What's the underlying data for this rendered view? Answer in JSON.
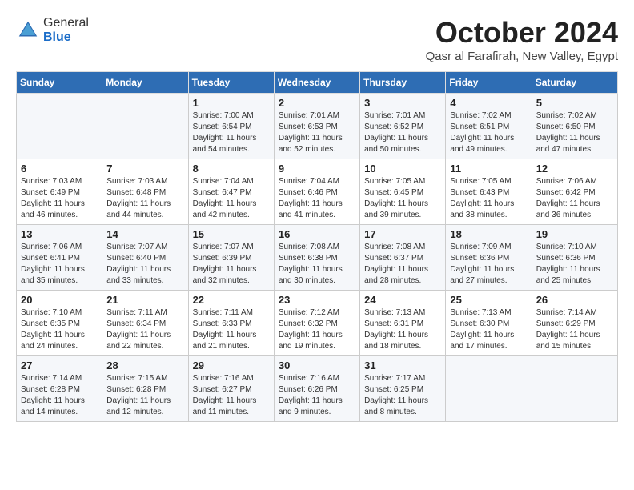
{
  "header": {
    "logo_general": "General",
    "logo_blue": "Blue",
    "month_title": "October 2024",
    "location": "Qasr al Farafirah, New Valley, Egypt"
  },
  "columns": [
    "Sunday",
    "Monday",
    "Tuesday",
    "Wednesday",
    "Thursday",
    "Friday",
    "Saturday"
  ],
  "weeks": [
    [
      {
        "day": "",
        "info": ""
      },
      {
        "day": "",
        "info": ""
      },
      {
        "day": "1",
        "info": "Sunrise: 7:00 AM\nSunset: 6:54 PM\nDaylight: 11 hours and 54 minutes."
      },
      {
        "day": "2",
        "info": "Sunrise: 7:01 AM\nSunset: 6:53 PM\nDaylight: 11 hours and 52 minutes."
      },
      {
        "day": "3",
        "info": "Sunrise: 7:01 AM\nSunset: 6:52 PM\nDaylight: 11 hours and 50 minutes."
      },
      {
        "day": "4",
        "info": "Sunrise: 7:02 AM\nSunset: 6:51 PM\nDaylight: 11 hours and 49 minutes."
      },
      {
        "day": "5",
        "info": "Sunrise: 7:02 AM\nSunset: 6:50 PM\nDaylight: 11 hours and 47 minutes."
      }
    ],
    [
      {
        "day": "6",
        "info": "Sunrise: 7:03 AM\nSunset: 6:49 PM\nDaylight: 11 hours and 46 minutes."
      },
      {
        "day": "7",
        "info": "Sunrise: 7:03 AM\nSunset: 6:48 PM\nDaylight: 11 hours and 44 minutes."
      },
      {
        "day": "8",
        "info": "Sunrise: 7:04 AM\nSunset: 6:47 PM\nDaylight: 11 hours and 42 minutes."
      },
      {
        "day": "9",
        "info": "Sunrise: 7:04 AM\nSunset: 6:46 PM\nDaylight: 11 hours and 41 minutes."
      },
      {
        "day": "10",
        "info": "Sunrise: 7:05 AM\nSunset: 6:45 PM\nDaylight: 11 hours and 39 minutes."
      },
      {
        "day": "11",
        "info": "Sunrise: 7:05 AM\nSunset: 6:43 PM\nDaylight: 11 hours and 38 minutes."
      },
      {
        "day": "12",
        "info": "Sunrise: 7:06 AM\nSunset: 6:42 PM\nDaylight: 11 hours and 36 minutes."
      }
    ],
    [
      {
        "day": "13",
        "info": "Sunrise: 7:06 AM\nSunset: 6:41 PM\nDaylight: 11 hours and 35 minutes."
      },
      {
        "day": "14",
        "info": "Sunrise: 7:07 AM\nSunset: 6:40 PM\nDaylight: 11 hours and 33 minutes."
      },
      {
        "day": "15",
        "info": "Sunrise: 7:07 AM\nSunset: 6:39 PM\nDaylight: 11 hours and 32 minutes."
      },
      {
        "day": "16",
        "info": "Sunrise: 7:08 AM\nSunset: 6:38 PM\nDaylight: 11 hours and 30 minutes."
      },
      {
        "day": "17",
        "info": "Sunrise: 7:08 AM\nSunset: 6:37 PM\nDaylight: 11 hours and 28 minutes."
      },
      {
        "day": "18",
        "info": "Sunrise: 7:09 AM\nSunset: 6:36 PM\nDaylight: 11 hours and 27 minutes."
      },
      {
        "day": "19",
        "info": "Sunrise: 7:10 AM\nSunset: 6:36 PM\nDaylight: 11 hours and 25 minutes."
      }
    ],
    [
      {
        "day": "20",
        "info": "Sunrise: 7:10 AM\nSunset: 6:35 PM\nDaylight: 11 hours and 24 minutes."
      },
      {
        "day": "21",
        "info": "Sunrise: 7:11 AM\nSunset: 6:34 PM\nDaylight: 11 hours and 22 minutes."
      },
      {
        "day": "22",
        "info": "Sunrise: 7:11 AM\nSunset: 6:33 PM\nDaylight: 11 hours and 21 minutes."
      },
      {
        "day": "23",
        "info": "Sunrise: 7:12 AM\nSunset: 6:32 PM\nDaylight: 11 hours and 19 minutes."
      },
      {
        "day": "24",
        "info": "Sunrise: 7:13 AM\nSunset: 6:31 PM\nDaylight: 11 hours and 18 minutes."
      },
      {
        "day": "25",
        "info": "Sunrise: 7:13 AM\nSunset: 6:30 PM\nDaylight: 11 hours and 17 minutes."
      },
      {
        "day": "26",
        "info": "Sunrise: 7:14 AM\nSunset: 6:29 PM\nDaylight: 11 hours and 15 minutes."
      }
    ],
    [
      {
        "day": "27",
        "info": "Sunrise: 7:14 AM\nSunset: 6:28 PM\nDaylight: 11 hours and 14 minutes."
      },
      {
        "day": "28",
        "info": "Sunrise: 7:15 AM\nSunset: 6:28 PM\nDaylight: 11 hours and 12 minutes."
      },
      {
        "day": "29",
        "info": "Sunrise: 7:16 AM\nSunset: 6:27 PM\nDaylight: 11 hours and 11 minutes."
      },
      {
        "day": "30",
        "info": "Sunrise: 7:16 AM\nSunset: 6:26 PM\nDaylight: 11 hours and 9 minutes."
      },
      {
        "day": "31",
        "info": "Sunrise: 7:17 AM\nSunset: 6:25 PM\nDaylight: 11 hours and 8 minutes."
      },
      {
        "day": "",
        "info": ""
      },
      {
        "day": "",
        "info": ""
      }
    ]
  ]
}
